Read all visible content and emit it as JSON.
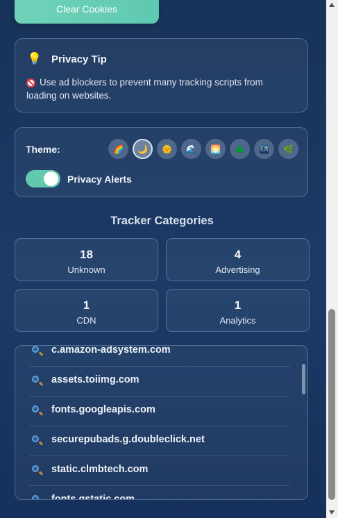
{
  "clear_button": {
    "label": "Clear Cookies"
  },
  "privacy_tip": {
    "title": "Privacy Tip",
    "icon": "lightbulb-icon",
    "text": "Use ad blockers to prevent many tracking scripts from loading on websites."
  },
  "settings": {
    "theme_label": "Theme:",
    "themes": [
      {
        "name": "rainbow",
        "glyph": "🌈",
        "selected": false
      },
      {
        "name": "moon",
        "glyph": "🌙",
        "selected": true
      },
      {
        "name": "sun",
        "glyph": "🌞",
        "selected": false
      },
      {
        "name": "wave",
        "glyph": "🌊",
        "selected": false
      },
      {
        "name": "sunset",
        "glyph": "🌅",
        "selected": false
      },
      {
        "name": "tree",
        "glyph": "🌲",
        "selected": false
      },
      {
        "name": "night-city",
        "glyph": "🌃",
        "selected": false
      },
      {
        "name": "leaf",
        "glyph": "🌿",
        "selected": false
      }
    ],
    "privacy_alerts_label": "Privacy Alerts",
    "privacy_alerts_on": true
  },
  "tracker_categories": {
    "title": "Tracker Categories",
    "items": [
      {
        "count": "18",
        "label": "Unknown"
      },
      {
        "count": "4",
        "label": "Advertising"
      },
      {
        "count": "1",
        "label": "CDN"
      },
      {
        "count": "1",
        "label": "Analytics"
      }
    ]
  },
  "domains": [
    "c.amazon-adsystem.com",
    "assets.toiimg.com",
    "fonts.googleapis.com",
    "securepubads.g.doubleclick.net",
    "static.clmbtech.com",
    "fonts.gstatic.com"
  ],
  "colors": {
    "accent": "#62c9ae",
    "background": "#1b3a66"
  }
}
